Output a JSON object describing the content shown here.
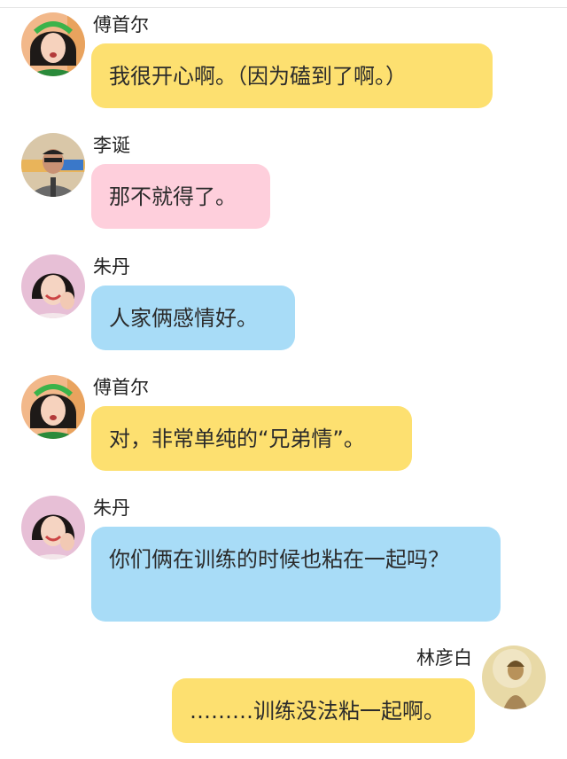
{
  "messages": [
    {
      "speaker": "傅首尔",
      "text": "我很开心啊。（因为磕到了啊。）",
      "color": "#fde070"
    },
    {
      "speaker": "李诞",
      "text": "那不就得了。",
      "color": "#fecfdc"
    },
    {
      "speaker": "朱丹",
      "text": "人家俩感情好。",
      "color": "#a8dcf7"
    },
    {
      "speaker": "傅首尔",
      "text": "对，非常单纯的“兄弟情”。",
      "color": "#fde070"
    },
    {
      "speaker": "朱丹",
      "text": "你们俩在训练的时候也粘在一起吗？",
      "color": "#a8dcf7"
    },
    {
      "speaker": "林彦白",
      "text": "………训练没法粘一起啊。",
      "color": "#fde070"
    }
  ]
}
